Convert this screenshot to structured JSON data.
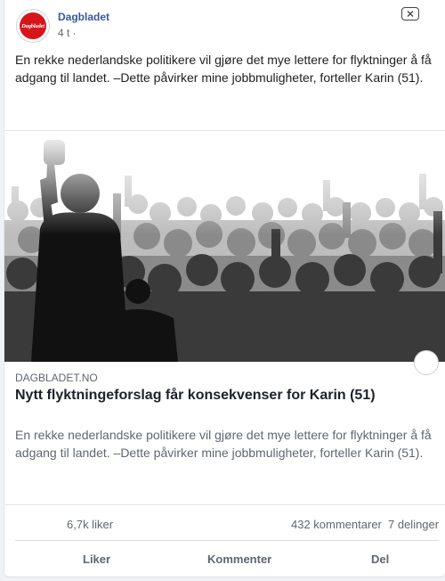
{
  "post": {
    "page_name": "Dagbladet",
    "time": "4 t ·",
    "text": "En rekke nederlandske politikere vil gjøre det mye lettere for flyktninger å få adgang til landet. –Dette påvirker mine jobbmuligheter, forteller Karin (51).",
    "avatar_logo_text": "Dagbladet"
  },
  "link": {
    "domain": "DAGBLADET.NO",
    "title": "Nytt flyktningeforslag får konsekvenser for Karin (51)",
    "description": "En rekke nederlandske politikere vil gjøre det mye lettere for flyktninger å få adgang til landet. –Dette påvirker mine jobbmuligheter, forteller Karin (51)."
  },
  "stats": {
    "likes": "6,7k liker",
    "comments": "432 kommentarer",
    "shares": "7 delinger"
  },
  "actions": {
    "like": "Liker",
    "comment": "Kommenter",
    "share": "Del"
  },
  "colors": {
    "brand_red": "#d7141a",
    "page_name": "#385898",
    "muted_text": "#606770"
  },
  "icons": {
    "close": "close-icon",
    "save": "save-circle-icon"
  }
}
